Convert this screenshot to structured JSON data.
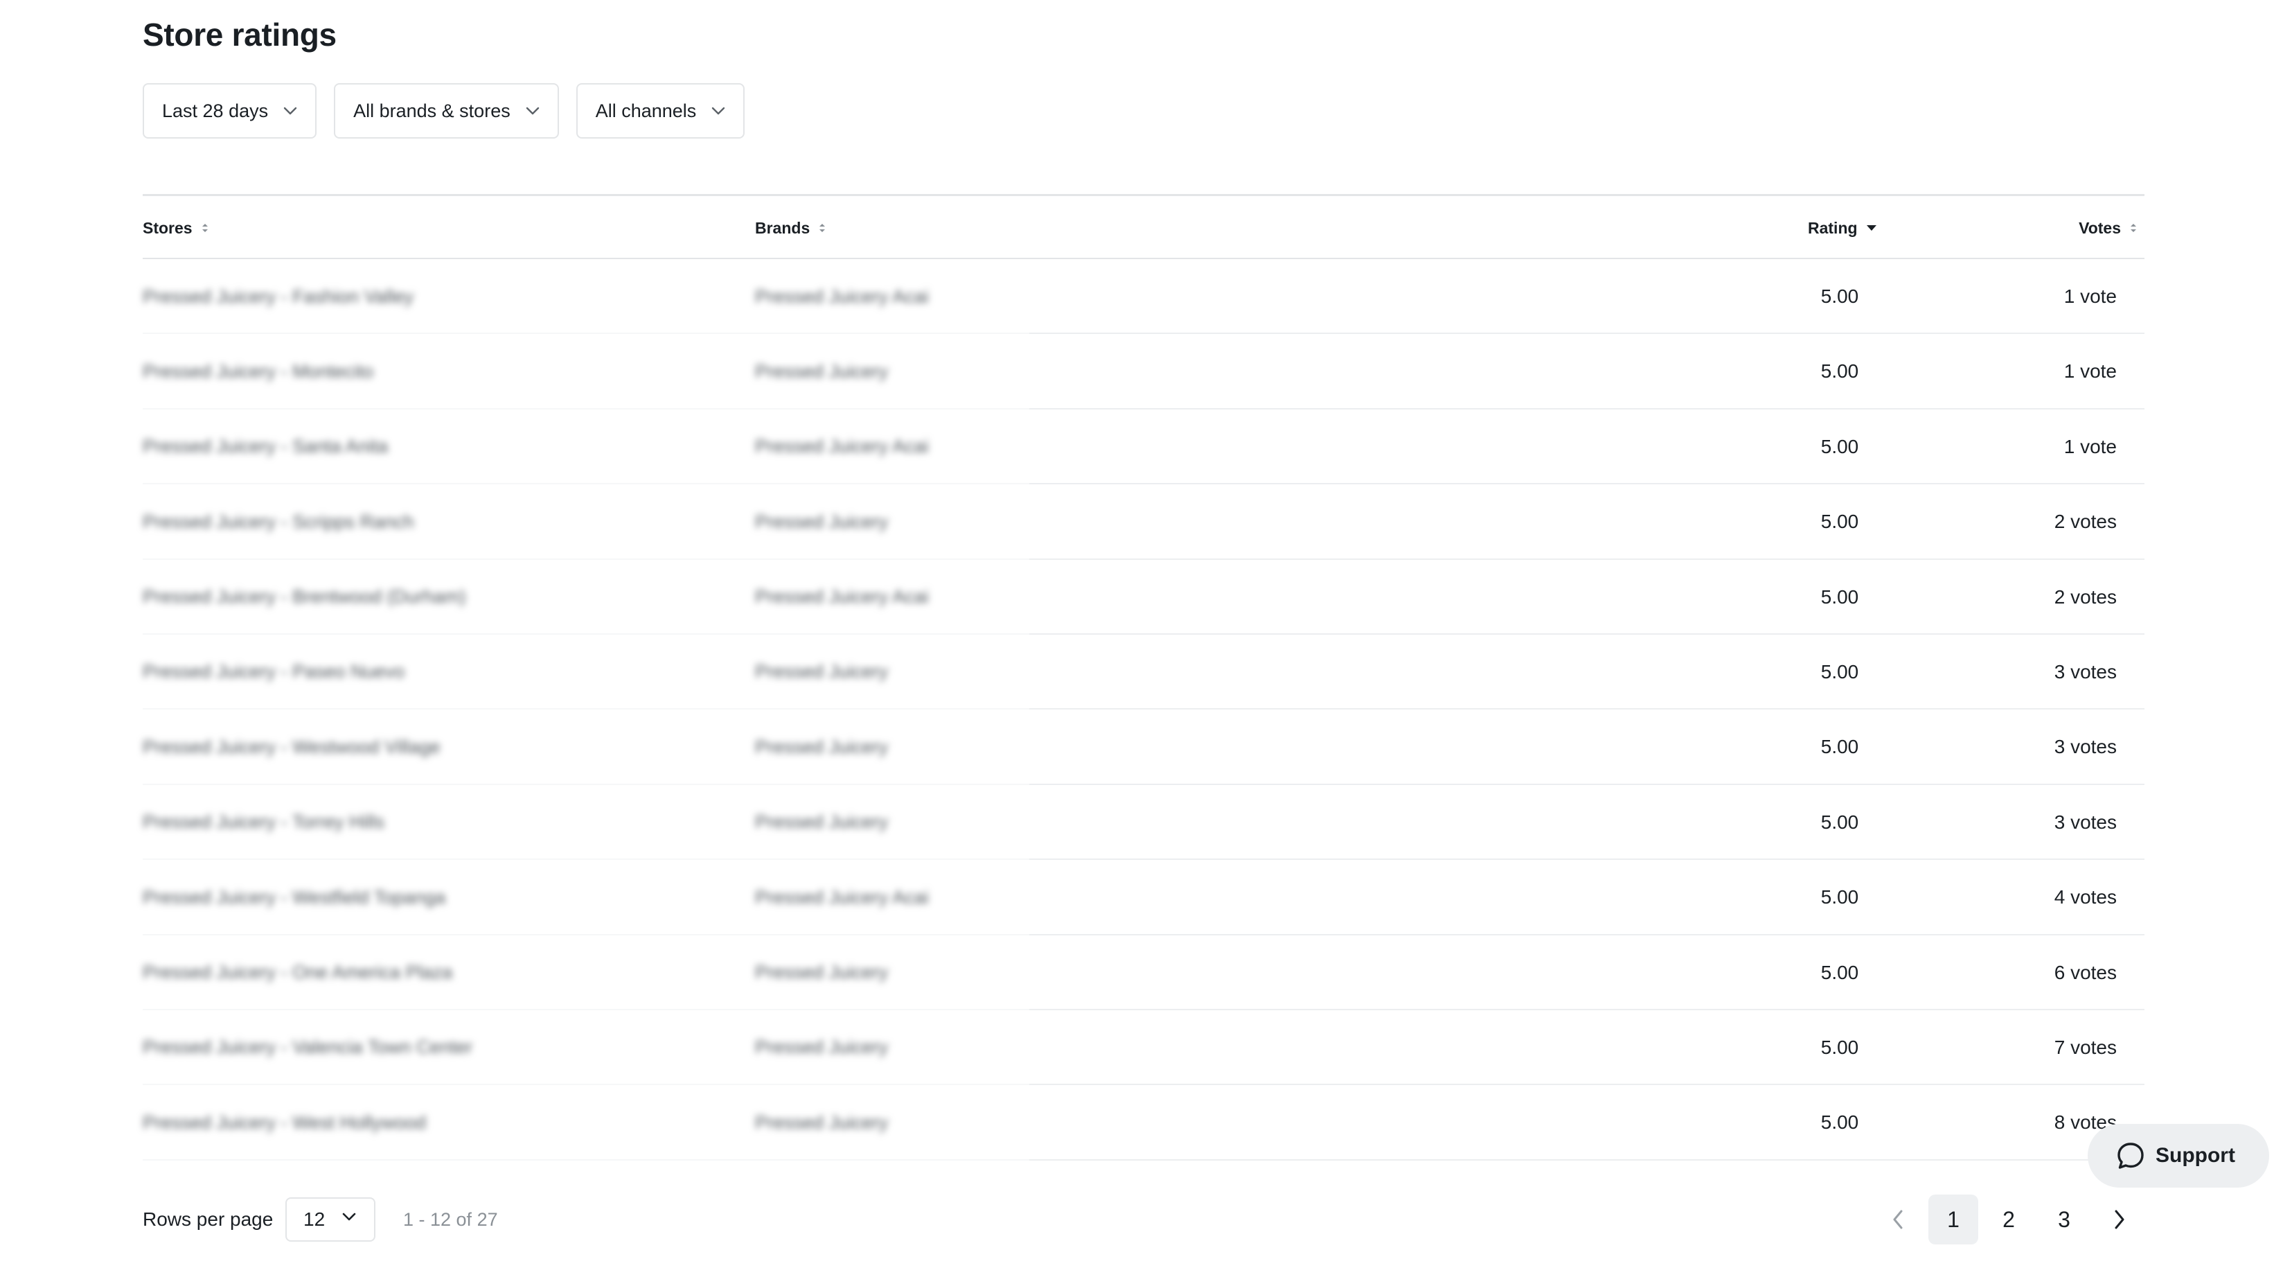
{
  "page": {
    "title": "Store ratings"
  },
  "filters": [
    {
      "label": "Last 28 days"
    },
    {
      "label": "All brands & stores"
    },
    {
      "label": "All channels"
    }
  ],
  "table": {
    "columns": {
      "stores": "Stores",
      "brands": "Brands",
      "rating": "Rating",
      "votes": "Votes"
    },
    "rows": [
      {
        "store": "Pressed Juicery - Fashion Valley",
        "brand": "Pressed Juicery Acai",
        "rating": "5.00",
        "votes": "1 vote"
      },
      {
        "store": "Pressed Juicery - Montecito",
        "brand": "Pressed Juicery",
        "rating": "5.00",
        "votes": "1 vote"
      },
      {
        "store": "Pressed Juicery - Santa Anita",
        "brand": "Pressed Juicery Acai",
        "rating": "5.00",
        "votes": "1 vote"
      },
      {
        "store": "Pressed Juicery - Scripps Ranch",
        "brand": "Pressed Juicery",
        "rating": "5.00",
        "votes": "2 votes"
      },
      {
        "store": "Pressed Juicery - Brentwood (Durham)",
        "brand": "Pressed Juicery Acai",
        "rating": "5.00",
        "votes": "2 votes"
      },
      {
        "store": "Pressed Juicery - Paseo Nuevo",
        "brand": "Pressed Juicery",
        "rating": "5.00",
        "votes": "3 votes"
      },
      {
        "store": "Pressed Juicery - Westwood Village",
        "brand": "Pressed Juicery",
        "rating": "5.00",
        "votes": "3 votes"
      },
      {
        "store": "Pressed Juicery - Torrey Hills",
        "brand": "Pressed Juicery",
        "rating": "5.00",
        "votes": "3 votes"
      },
      {
        "store": "Pressed Juicery - Westfield Topanga",
        "brand": "Pressed Juicery Acai",
        "rating": "5.00",
        "votes": "4 votes"
      },
      {
        "store": "Pressed Juicery - One America Plaza",
        "brand": "Pressed Juicery",
        "rating": "5.00",
        "votes": "6 votes"
      },
      {
        "store": "Pressed Juicery - Valencia Town Center",
        "brand": "Pressed Juicery",
        "rating": "5.00",
        "votes": "7 votes"
      },
      {
        "store": "Pressed Juicery - West Hollywood",
        "brand": "Pressed Juicery",
        "rating": "5.00",
        "votes": "8 votes"
      }
    ]
  },
  "pagination": {
    "rows_per_page_label": "Rows per page",
    "rows_per_page_value": "12",
    "range_text": "1 - 12 of 27",
    "pages": [
      "1",
      "2",
      "3"
    ],
    "current_page": "1"
  },
  "support": {
    "label": "Support"
  },
  "icons": {
    "dropdown": "chevron-down-icon",
    "sort": "sort-icon",
    "sort_desc": "caret-down-icon",
    "prev": "chevron-left-icon",
    "next": "chevron-right-icon",
    "support": "chat-bubble-icon"
  }
}
